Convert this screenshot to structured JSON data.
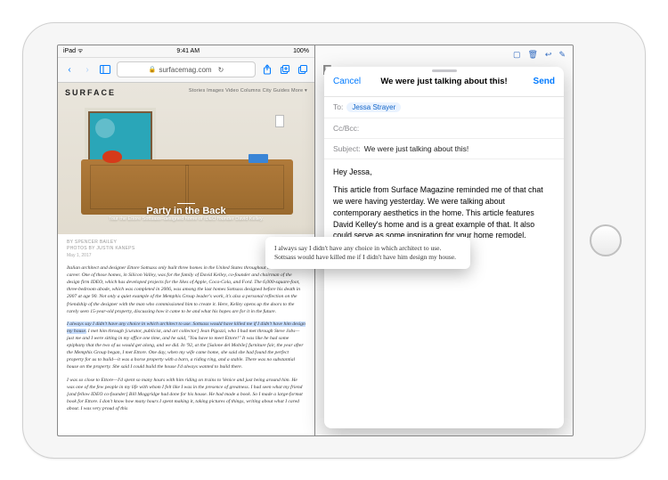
{
  "statusbar": {
    "carrier": "iPad ᯤ",
    "time": "9:41 AM",
    "battery": "100%"
  },
  "safari": {
    "url": "surfacemag.com",
    "brand": "SURFACE",
    "topnav": "Stories   Images   Video   Columns   City Guides   More ▾",
    "hero_title": "Party in the Back",
    "hero_sub": "Tour the Ettore Sottsass–designed home of IDEO founder David Kelley.",
    "byline": "BY SPENCER BAILEY",
    "credit": "PHOTOS BY JUSTIN KANEPS",
    "date": "May 1, 2017",
    "para1": "Italian architect and designer Ettore Sottsass only built three homes in the United States throughout his illustrious career. One of those homes, in Silicon Valley, was for the family of David Kelley, co-founder and chairman of the design firm IDEO, which has developed projects for the likes of Apple, Coca-Cola, and Ford. The 6,000-square-foot, three-bedroom abode, which was completed in 2006, was among the last homes Sottsass designed before his death in 2007 at age 90. Not only a quiet example of the Memphis Group leader's work, it's also a personal reflection on the friendship of the designer with the man who commissioned him to create it. Here, Kelley opens up the doors to the rarely seen 15-year-old property, discussing how it came to be and what his hopes are for it in the future.",
    "highlight": "I always say I didn't have any choice in which architect to use. Sottsass would have killed me if I didn't have him design my house.",
    "para2_rest": " I met him through [curator, publicist, and art collector] Jean Pigozzi, who I had met through Steve Jobs—just me and I were sitting in my office one time, and he said, \"You have to meet Ettore!\" It was like he had some epiphany that the two of us would get along, and we did. In '92, at the [Salone del Mobile] furniture fair, the year after the Memphis Group began, I met Ettore. One day, when my wife came home, she said she had found the perfect property for us to build—it was a horse property with a barn, a riding ring, and a stable. There was no substantial house on the property. She said I could build the house I'd always wanted to build there.",
    "para3": "I was so close to Ettore—I'd spent so many hours with him riding on trains to Venice and just being around him. He was one of the few people in my life with whom I felt like I was in the presence of greatness. I had seen what my friend [and fellow IDEO co-founder] Bill Moggridge had done for his house. He had made a book. So I made a large-format book for Ettore. I don't know how many hours I spent making it, taking pictures of things, writing about what I cared about. I was very proud of this"
  },
  "drag_text": "I always say I didn't have any choice in which architect to use. Sottsass would have killed me if I didn't have him design my house.",
  "mail": {
    "cancel": "Cancel",
    "send": "Send",
    "title": "We were just talking about this!",
    "to_label": "To:",
    "to_value": "Jessa Strayer",
    "cc_label": "Cc/Bcc:",
    "subject_label": "Subject:",
    "subject_value": "We were just talking about this!",
    "greeting": "Hey Jessa,",
    "body": "This article from Surface Magazine reminded me of that chat we were having yesterday. We were talking about contemporary aesthetics in the home. This article features David Kelley's home and is a great example of that. It also could serve as some inspiration for your home remodel."
  },
  "behind": {
    "big": "E"
  }
}
